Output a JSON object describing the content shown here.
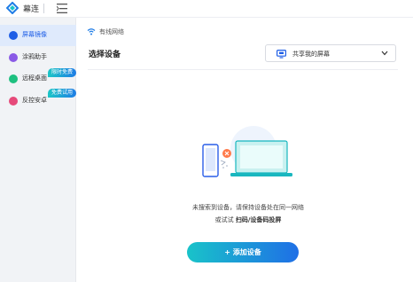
{
  "titlebar": {
    "app_name": "幕连"
  },
  "sidebar": {
    "items": [
      {
        "label": "屏幕镜像",
        "active": true,
        "badge": ""
      },
      {
        "label": "涂鸦助手",
        "active": false,
        "badge": ""
      },
      {
        "label": "远程桌面",
        "active": false,
        "badge": "限时免费"
      },
      {
        "label": "反控安卓",
        "active": false,
        "badge": "免费试用"
      }
    ]
  },
  "main": {
    "network_label": "有线网络",
    "select_title": "选择设备",
    "dropdown_value": "共享我的屏幕",
    "empty_msg_line1": "未搜索到设备，请保持设备处在同一网络",
    "empty_msg_line2_prefix": "或试试 ",
    "empty_msg_line2_link": "扫码/设备码投屏",
    "add_button_label": "+ 添加设备"
  },
  "colors": {
    "accent": "#1e5ee6",
    "teal": "#19c3c9",
    "sidebar_bg": "#f1f3f6",
    "active_bg": "#dfeafc"
  }
}
